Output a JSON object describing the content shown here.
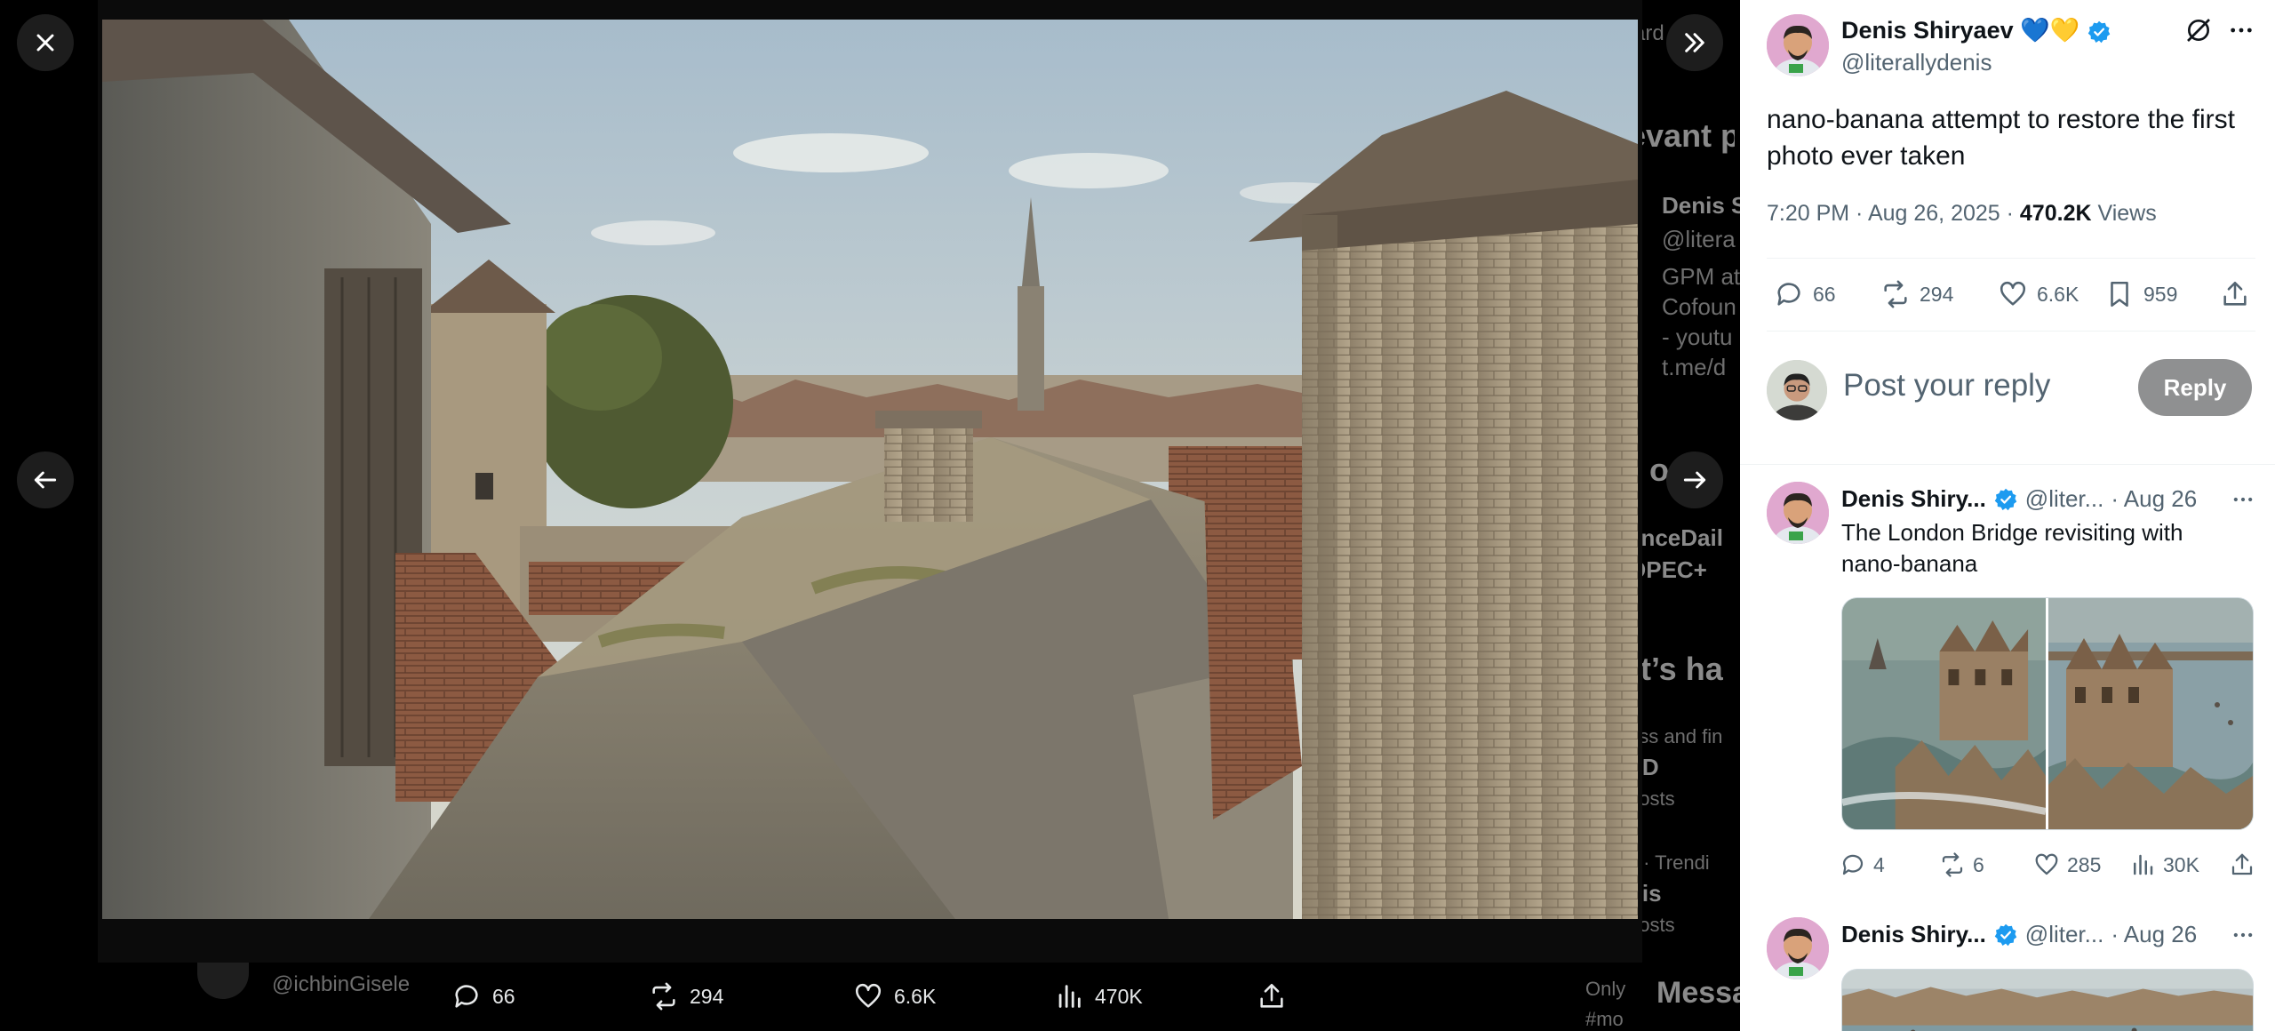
{
  "background": {
    "lines": [
      "ard",
      "evant p",
      "Denis S",
      "@litera",
      "GPM at",
      "Cofoun",
      "- youtu",
      "t.me/d",
      "e o",
      "anceDail",
      "OPEC+",
      "at’s ha",
      "ess and fin",
      "LD",
      "posts",
      "s · Trendi",
      "dis",
      "posts",
      "Only",
      "Messa",
      "#mo",
      "@ichbinGisele"
    ]
  },
  "viewer": {
    "bottom_bar": {
      "replies": "66",
      "reposts": "294",
      "likes": "6.6K",
      "views": "470K"
    }
  },
  "post": {
    "author_name": "Denis Shiryaev",
    "author_emojis": "💙💛",
    "author_handle": "@literallydenis",
    "text_line1": "nano-banana attempt to restore the first",
    "text_line2": "photo ever taken",
    "meta_time": "7:20 PM · Aug 26, 2025 · ",
    "meta_views_count": "470.2K",
    "meta_views_label": " Views",
    "replies": "66",
    "reposts": "294",
    "likes": "6.6K",
    "bookmarks": "959"
  },
  "reply_box": {
    "placeholder": "Post your reply",
    "button": "Reply"
  },
  "replies": [
    {
      "name": "Denis Shiry...",
      "handle": "@liter...",
      "date": "· Aug 26",
      "text_line1": "The London Bridge revisiting with",
      "text_line2": "nano-banana",
      "replies": "4",
      "reposts": "6",
      "likes": "285",
      "views": "30K"
    },
    {
      "name": "Denis Shiry...",
      "handle": "@liter...",
      "date": "· Aug 26"
    }
  ],
  "colors": {
    "verified_blue": "#1d9bf0",
    "reply_button_bg": "#8f9091",
    "muted_text": "#536471"
  }
}
